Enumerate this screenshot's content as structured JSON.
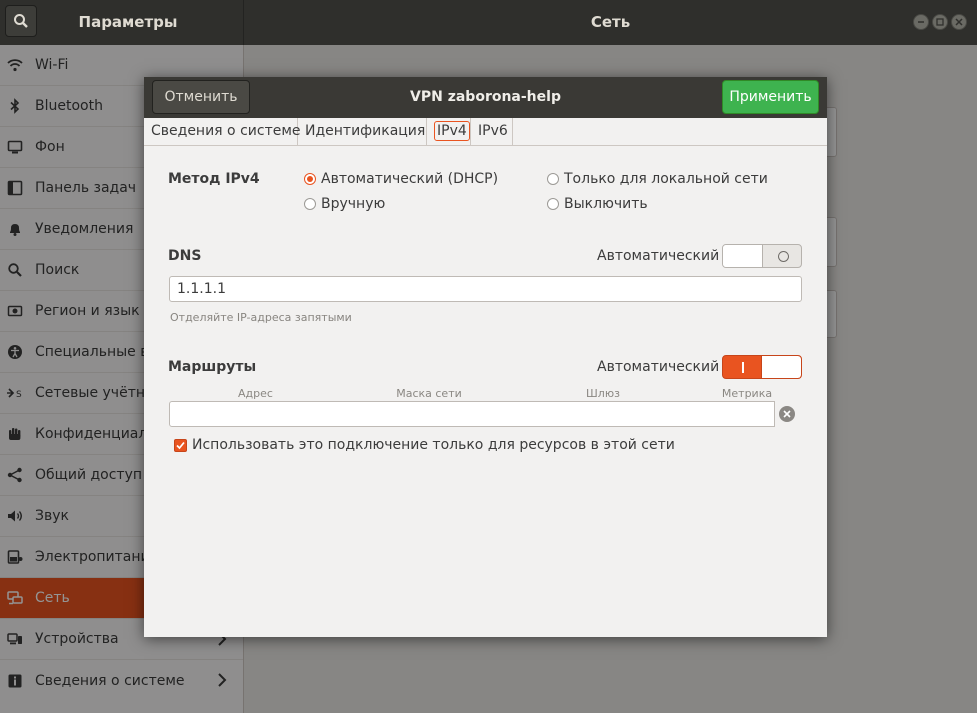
{
  "app": {
    "left_title": "Параметры",
    "main_title": "Сеть"
  },
  "sidebar": {
    "items": [
      {
        "label": "Wi-Fi",
        "icon": "wifi-icon"
      },
      {
        "label": "Bluetooth",
        "icon": "bluetooth-icon"
      },
      {
        "label": "Фон",
        "icon": "background-icon"
      },
      {
        "label": "Панель задач",
        "icon": "dock-icon"
      },
      {
        "label": "Уведомления",
        "icon": "bell-icon"
      },
      {
        "label": "Поиск",
        "icon": "search-icon"
      },
      {
        "label": "Регион и язык",
        "icon": "region-icon"
      },
      {
        "label": "Специальные во",
        "icon": "accessibility-icon"
      },
      {
        "label": "Сетевые учётны",
        "icon": "online-accounts-icon"
      },
      {
        "label": "Конфиденциальн",
        "icon": "privacy-hand-icon"
      },
      {
        "label": "Общий доступ",
        "icon": "share-icon"
      },
      {
        "label": "Звук",
        "icon": "speaker-icon"
      },
      {
        "label": "Электропитани",
        "icon": "power-icon"
      },
      {
        "label": "Сеть",
        "icon": "network-icon",
        "active": true
      },
      {
        "label": "Устройства",
        "icon": "devices-icon",
        "chevron": true
      },
      {
        "label": "Сведения о системе",
        "icon": "info-icon",
        "chevron": true
      }
    ]
  },
  "dialog": {
    "title": "VPN zaborona-help",
    "cancel_label": "Отменить",
    "apply_label": "Применить",
    "tabs": [
      "Сведения о системе",
      "Идентификация",
      "IPv4",
      "IPv6"
    ],
    "active_tab": "IPv4",
    "ipv4": {
      "method_label": "Метод IPv4",
      "methods": {
        "auto_dhcp": "Автоматический (DHCP)",
        "manual": "Вручную",
        "link_local": "Только для локальной сети",
        "disabled": "Выключить"
      },
      "selected_method": "auto_dhcp",
      "dns": {
        "label": "DNS",
        "auto_label": "Автоматический",
        "auto_enabled": false,
        "value": "1.1.1.1",
        "hint": "Отделяйте IP-адреса запятыми"
      },
      "routes": {
        "label": "Маршруты",
        "auto_label": "Автоматический",
        "auto_enabled": true,
        "columns": [
          "Адрес",
          "Маска сети",
          "Шлюз",
          "Метрика"
        ],
        "only_resources_label": "Использовать это подключение только для ресурсов в этой сети",
        "only_resources_checked": true
      }
    }
  },
  "colors": {
    "accent": "#e95420",
    "apply": "#3eb34f",
    "titlebar": "#2f2f2c"
  }
}
